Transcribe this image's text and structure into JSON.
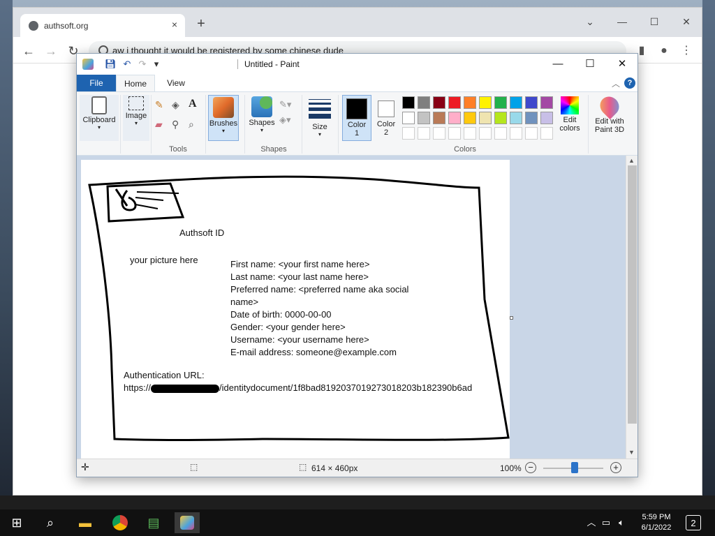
{
  "browser": {
    "tab_title": "authsoft.org",
    "tab_close": "×",
    "new_tab": "+",
    "address": "aw i thought it would be registered by some chinese dude",
    "controls": {
      "minimize": "—",
      "maximize": "☐",
      "close": "✕",
      "dropdown": "⌄"
    },
    "nav": {
      "back": "←",
      "forward": "→",
      "reload": "↻"
    }
  },
  "paint": {
    "title": "Untitled - Paint",
    "ribbon_tabs": [
      "File",
      "Home",
      "View"
    ],
    "groups": {
      "clipboard": "Clipboard",
      "image": "Image",
      "tools": "Tools",
      "brushes": "Brushes",
      "shapes_btn": "Shapes",
      "shapes_group": "Shapes",
      "size": "Size",
      "color1": "Color\n1",
      "color2": "Color\n2",
      "colors": "Colors",
      "edit_colors": "Edit\ncolors",
      "edit_paint3d": "Edit with\nPaint 3D"
    },
    "palette_row1": [
      "#000000",
      "#7f7f7f",
      "#880015",
      "#ed1c24",
      "#ff7f27",
      "#fff200",
      "#22b14c",
      "#00a2e8",
      "#3f48cc",
      "#a349a4"
    ],
    "palette_row2": [
      "#ffffff",
      "#c3c3c3",
      "#b97a57",
      "#ffaec9",
      "#ffc90e",
      "#efe4b0",
      "#b5e61d",
      "#99d9ea",
      "#7092be",
      "#c8bfe7"
    ],
    "status": {
      "dimensions": "614 × 460px",
      "zoom": "100%"
    }
  },
  "document": {
    "heading": "Authsoft ID",
    "picture_placeholder": "your picture here",
    "fields": [
      "First name: <your first name here>",
      "Last name: <your last name here>",
      "Preferred name: <preferred name aka social",
      "name>",
      "Date of birth: 0000-00-00",
      "Gender: <your gender here>",
      "Username: <your username here>",
      "E-mail address: someone@example.com"
    ],
    "auth_label": "Authentication URL:",
    "auth_url_prefix": "https://",
    "auth_url_suffix": "/identitydocument/1f8bad8192037019273018203b182390b6ad"
  },
  "taskbar": {
    "time": "5:59 PM",
    "date": "6/1/2022",
    "notifications": "2"
  }
}
